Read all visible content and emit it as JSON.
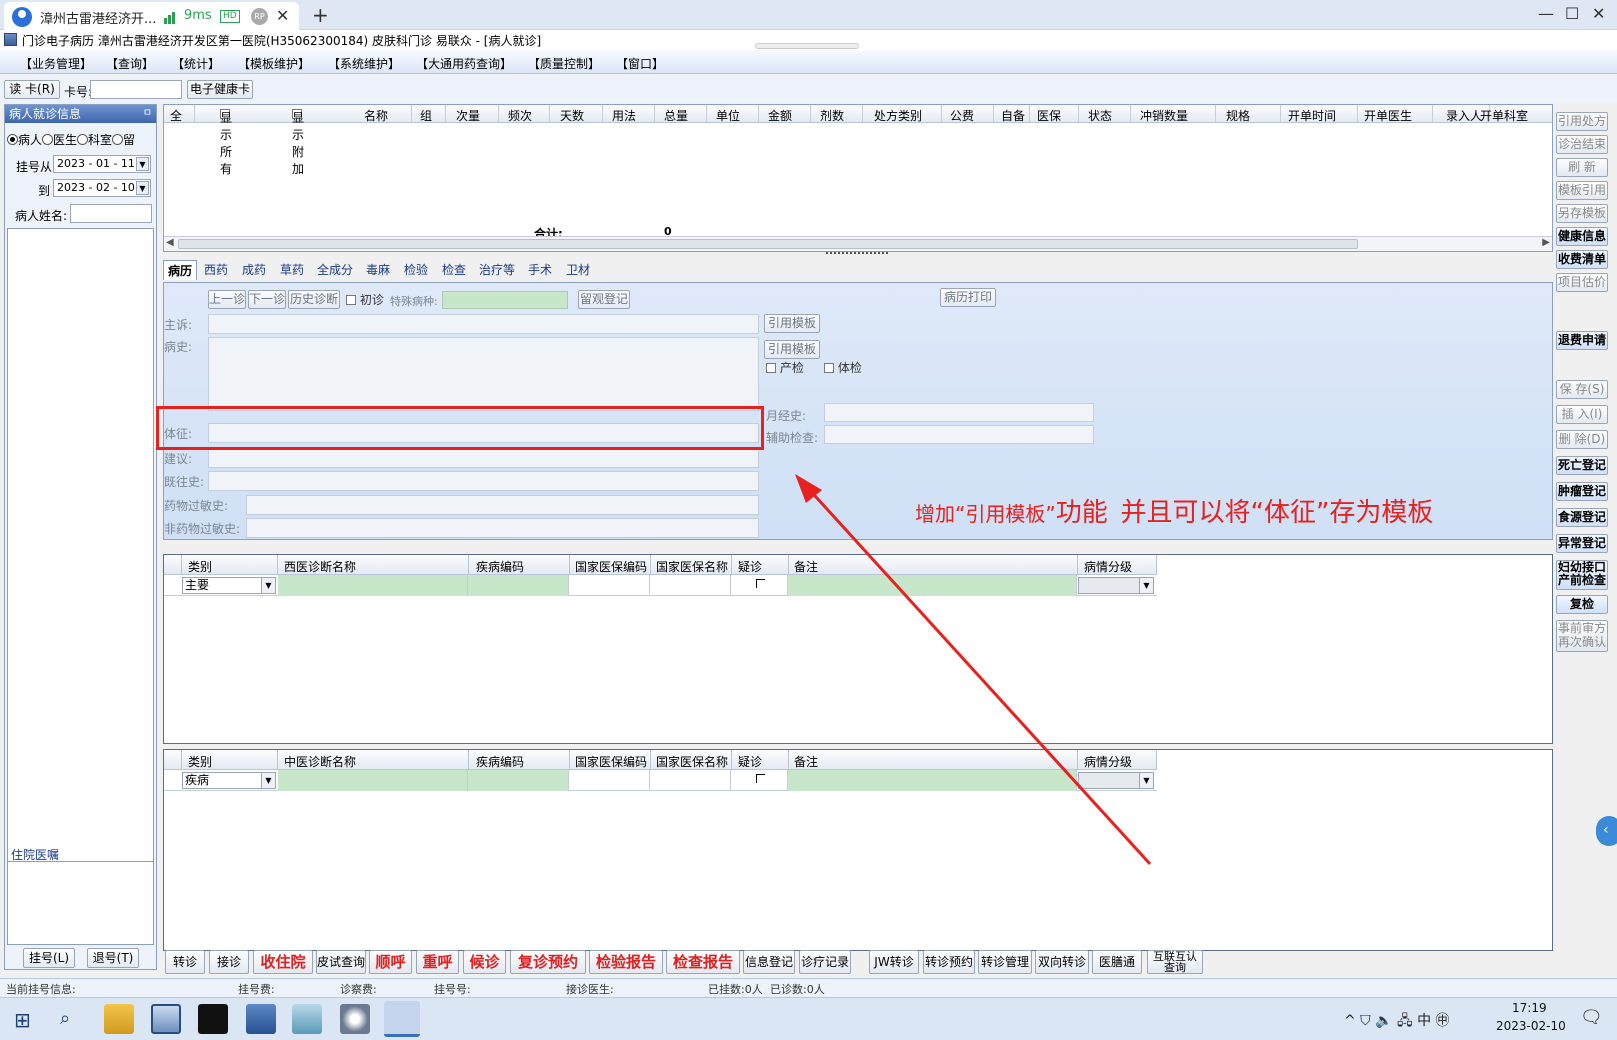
{
  "remote_tab": {
    "title": "漳州古雷港经济开...",
    "latency": "9ms",
    "hd": "HD",
    "rp": "RP",
    "close": "✕",
    "new_tab": "+"
  },
  "remote_window": {
    "min": "—",
    "max": "☐",
    "close": "✕"
  },
  "app": {
    "title": "门诊电子病历   漳州古雷港经济开发区第一医院(H35062300184)  皮肤科门诊  易联众 - [病人就诊]"
  },
  "app_window": {
    "min": "—",
    "restore": "❐",
    "close": "✕"
  },
  "menu": [
    "【业务管理】",
    "【查询】",
    "【统计】",
    "【模板维护】",
    "【系统维护】",
    "【大通用药查询】",
    "【质量控制】",
    "【窗口】"
  ],
  "toolbar": {
    "read_card": "读 卡(R)",
    "card_no_label": "卡号:",
    "card_no_value": "",
    "health_card": "电子健康卡"
  },
  "left": {
    "header": "病人就诊信息",
    "pin": "ㅁ",
    "radios": [
      "病人",
      "医生",
      "科室",
      "留"
    ],
    "reg_from_label": "挂号从",
    "reg_from": "2023 - 01 - 11",
    "reg_to_label": "到",
    "reg_to": "2023 - 02 - 10",
    "name_label": "病人姓名:",
    "name_value": "",
    "inpatient_orders": "住院医嘱",
    "register_btn": "挂号(L)",
    "unregister_btn": "退号(T)"
  },
  "rx_grid": {
    "columns": [
      "全",
      "显示所有",
      "显示附加",
      "名称",
      "组",
      "次量",
      "频次",
      "天数",
      "用法",
      "总量",
      "单位",
      "金额",
      "剂数",
      "处方类别",
      "公费",
      "自备",
      "医保",
      "状态",
      "冲销数量",
      "规格",
      "开单时间",
      "开单医生",
      "录入人",
      "开单科室"
    ],
    "total_label": "合计:",
    "total_value": "0"
  },
  "tabs": [
    "病历",
    "西药",
    "成药",
    "草药",
    "全成分",
    "毒麻",
    "检验",
    "检查",
    "治疗等",
    "手术",
    "卫材"
  ],
  "record": {
    "prev": "上一诊",
    "next": "下一诊",
    "history": "历史诊断",
    "first_visit": "初诊",
    "special": "特殊病种:",
    "observe": "留观登记",
    "print": "病历打印",
    "complaint": "主诉:",
    "cite_template": "引用模板",
    "history_label": "病史:",
    "cite_template2": "引用模板",
    "prenatal": "产检",
    "physical": "体检",
    "sign": "体征:",
    "menstrual": "月经史:",
    "aux_exam": "辅助检查:",
    "advice": "建议:",
    "past_history": "既往史:",
    "drug_allergy": "药物过敏史:",
    "nondrug_allergy": "非药物过敏史:"
  },
  "western_diag": {
    "columns": [
      "类别",
      "西医诊断名称",
      "疾病编码",
      "国家医保编码",
      "国家医保名称",
      "疑诊",
      "备注",
      "病情分级"
    ],
    "row_type": "主要"
  },
  "tcm_diag": {
    "columns": [
      "类别",
      "中医诊断名称",
      "疾病编码",
      "国家医保编码",
      "国家医保名称",
      "疑诊",
      "备注",
      "病情分级"
    ],
    "row_type": "疾病"
  },
  "bottom_buttons": [
    "转诊",
    "接诊",
    "收住院",
    "皮试查询",
    "顺呼",
    "重呼",
    "候诊",
    "复诊预约",
    "检验报告",
    "检查报告",
    "信息登记",
    "诊疗记录",
    "JW转诊",
    "转诊预约",
    "转诊管理",
    "双向转诊",
    "医膳通",
    "互联互认查询"
  ],
  "right_buttons": [
    "引用处方",
    "诊治结束",
    "刷 新",
    "模板引用",
    "另存模板",
    "健康信息",
    "收费清单",
    "项目估价",
    "退费申请",
    "保 存(S)",
    "插 入(I)",
    "删 除(D)",
    "死亡登记",
    "肿瘤登记",
    "食源登记",
    "异常登记",
    "妇幼接口产前检查",
    "复检",
    "事前审方再次确认"
  ],
  "status": {
    "current": "当前挂号信息:",
    "fee": "挂号费:",
    "consult": "诊察费:",
    "reg_no": "挂号号:",
    "doctor": "接诊医生:",
    "registered": "已挂数:0人",
    "seen": "已诊数:0人"
  },
  "taskbar": {
    "tray": "^  ⛉  🔈  🖧  中  ㊥",
    "time": "17:19",
    "date": "2023-02-10",
    "notify": "🗨"
  },
  "annotation": {
    "part1": "增加“引用模板”",
    "part2": "功能",
    "part3": "并且可以将“体征”存为模板"
  },
  "colors": {
    "annotation": "#e8201e",
    "header_blue": "#3f66ad",
    "form_bg": "#d8e6f7",
    "green_cell": "#c8e6c9",
    "red_button_text": "#e0201f"
  }
}
